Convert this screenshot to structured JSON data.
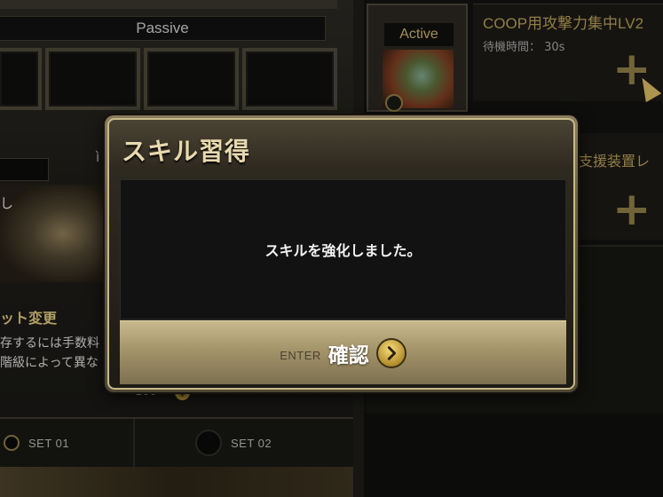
{
  "background": {
    "passive_label": "Passive",
    "tab_glyph": "ì",
    "card_text": "し",
    "set_title": "ット変更",
    "set_desc_lines": [
      "存するには手数料",
      "階級によって異な"
    ],
    "cost_value": "100",
    "set_buttons": [
      {
        "label": "SET 01"
      },
      {
        "label": "SET 02"
      }
    ],
    "active_label": "Active",
    "skill_name": "COOP用攻撃力集中LV2",
    "skill_wait": "待機時間： 30s",
    "skill_name2": "支援装置レ",
    "plus_glyph": "+"
  },
  "dialog": {
    "title": "スキル習得",
    "message": "スキルを強化しました。",
    "enter_hint": "ENTER",
    "confirm_label": "確認"
  },
  "colors": {
    "accent_gold": "#c9b987",
    "title_text": "#e8d9ae",
    "button_gold": "#a3946a"
  }
}
